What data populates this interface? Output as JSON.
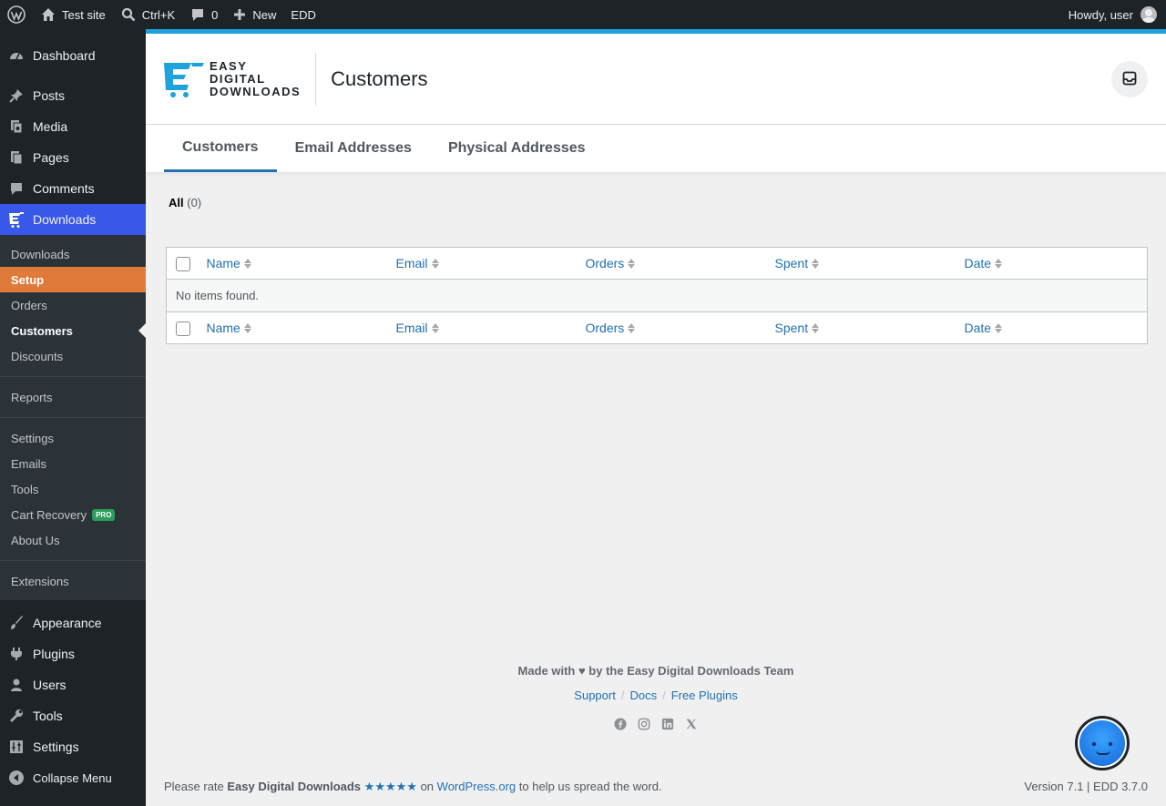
{
  "adminbar": {
    "site_name": "Test site",
    "search_shortcut": "Ctrl+K",
    "comments_count": "0",
    "new_label": "New",
    "edd_label": "EDD",
    "howdy": "Howdy, user"
  },
  "sidebar": {
    "dashboard": "Dashboard",
    "posts": "Posts",
    "media": "Media",
    "pages": "Pages",
    "comments": "Comments",
    "downloads": "Downloads",
    "submenu": {
      "downloads": "Downloads",
      "setup": "Setup",
      "orders": "Orders",
      "customers": "Customers",
      "discounts": "Discounts",
      "reports": "Reports",
      "settings": "Settings",
      "emails": "Emails",
      "tools": "Tools",
      "cart_recovery": "Cart Recovery",
      "pro_badge": "PRO",
      "about_us": "About Us",
      "extensions": "Extensions"
    },
    "appearance": "Appearance",
    "plugins": "Plugins",
    "users": "Users",
    "tools": "Tools",
    "settings": "Settings",
    "collapse": "Collapse Menu"
  },
  "header": {
    "logo_line1": "EASY",
    "logo_line2": "DIGITAL",
    "logo_line3": "DOWNLOADS",
    "title": "Customers"
  },
  "tabs": {
    "customers": "Customers",
    "email_addresses": "Email Addresses",
    "physical_addresses": "Physical Addresses"
  },
  "filters": {
    "all_label": "All",
    "all_count": "(0)"
  },
  "table": {
    "columns": {
      "name": "Name",
      "email": "Email",
      "orders": "Orders",
      "spent": "Spent",
      "date": "Date"
    },
    "empty_message": "No items found."
  },
  "footer": {
    "made_with": "Made with ♥ by the Easy Digital Downloads Team",
    "support": "Support",
    "docs": "Docs",
    "free_plugins": "Free Plugins",
    "separator": "/",
    "rate_prefix": "Please rate",
    "rate_product": "Easy Digital Downloads",
    "rate_stars": "★★★★★",
    "rate_on": "on",
    "rate_site": "WordPress.org",
    "rate_suffix": "to help us spread the word.",
    "version": "Version 7.1 | EDD 3.7.0"
  },
  "colors": {
    "accent": "#3858e9",
    "setup": "#e07a3b",
    "header_border": "#1ea2dc",
    "link": "#2271b1"
  }
}
